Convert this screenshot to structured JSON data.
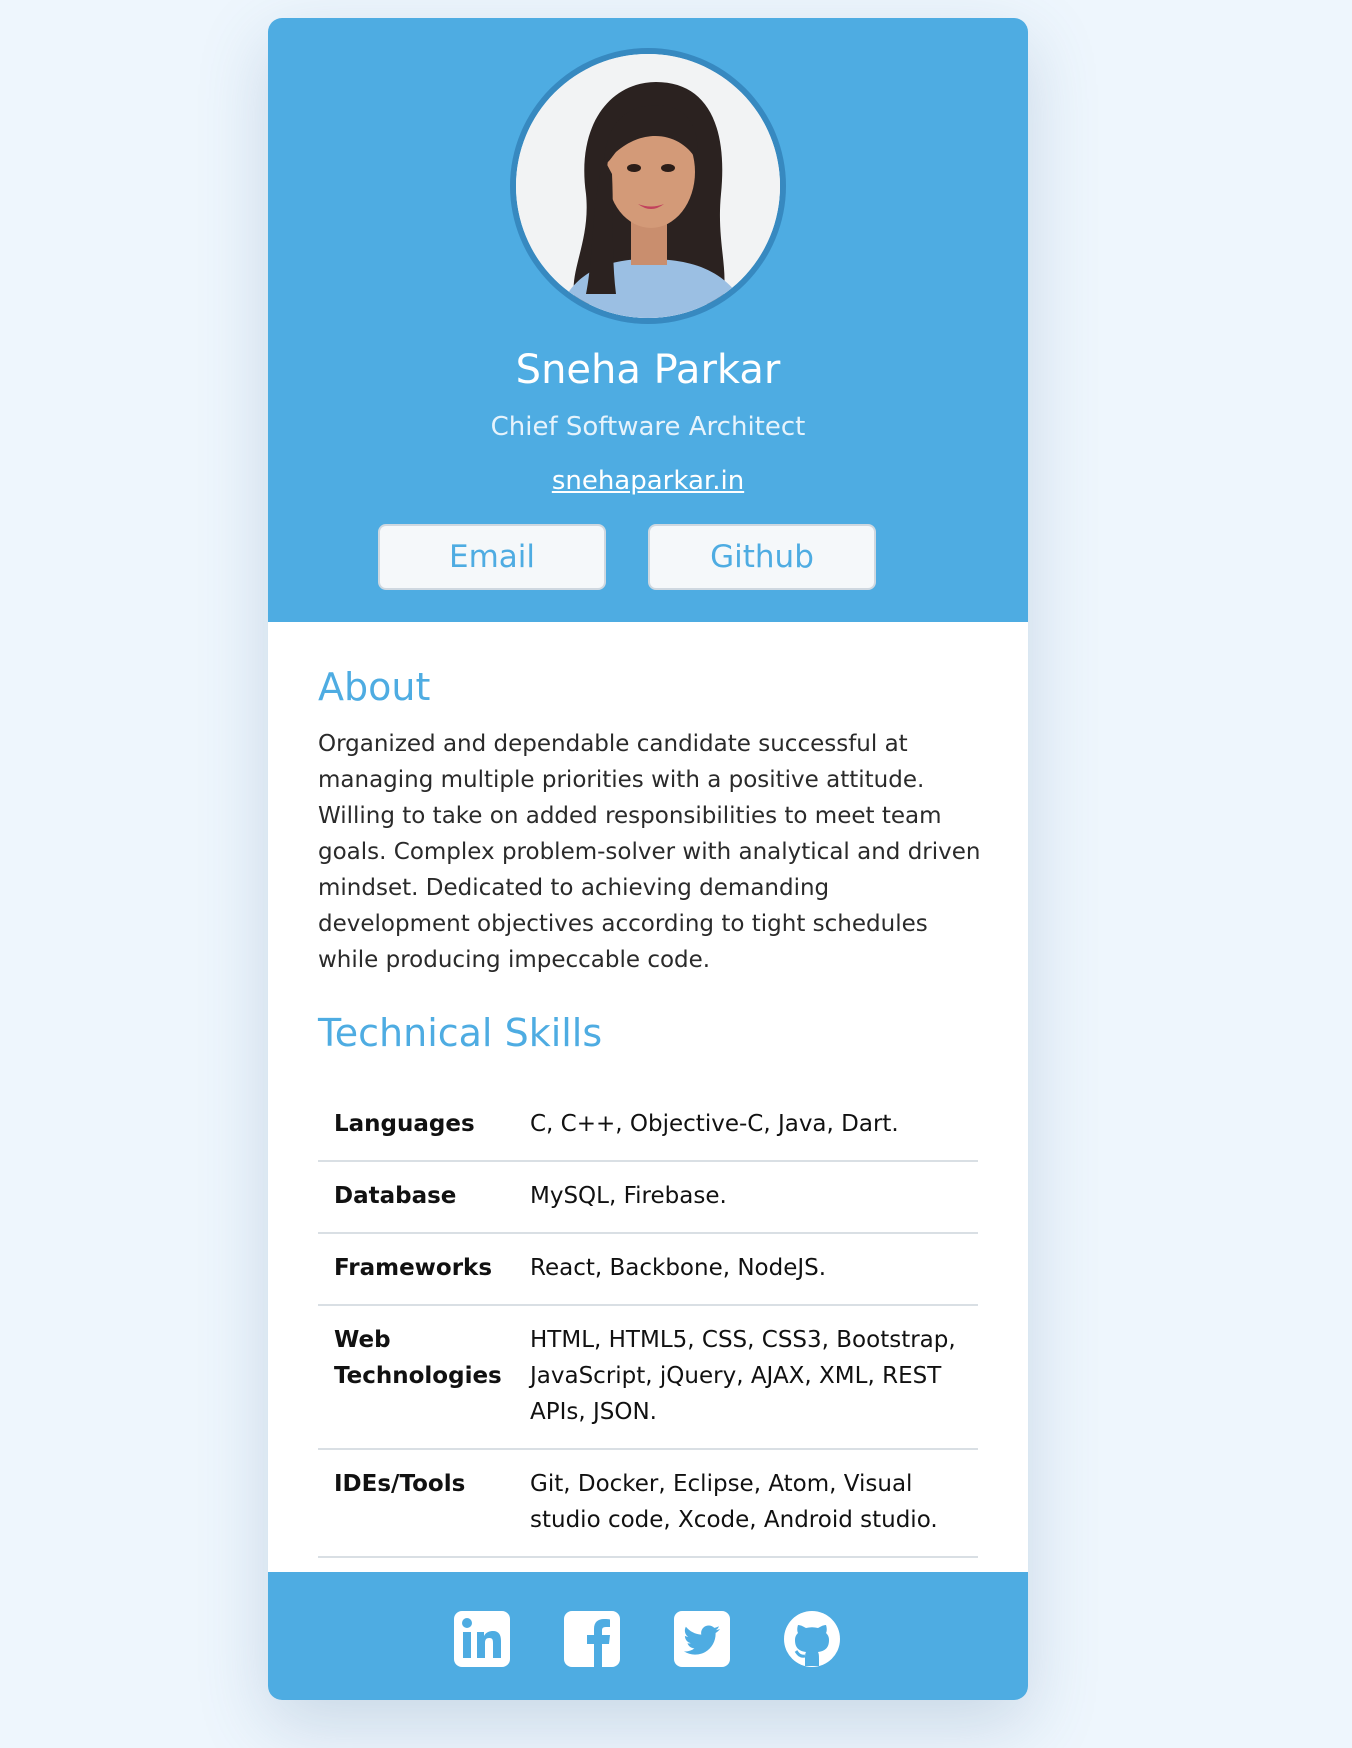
{
  "profile": {
    "name": "Sneha Parkar",
    "role": "Chief Software Architect",
    "website": "snehaparkar.in"
  },
  "buttons": {
    "email": "Email",
    "github": "Github"
  },
  "about": {
    "title": "About",
    "text": "Organized and dependable candidate successful at managing multiple priorities with a positive attitude. Willing to take on added responsibilities to meet team goals. Complex problem-solver with analytical and driven mindset. Dedicated to achieving demanding development objectives according to tight schedules while producing impeccable code."
  },
  "skills": {
    "title": "Technical Skills",
    "rows": [
      {
        "key": "Languages",
        "value": "C, C++, Objective-C, Java, Dart."
      },
      {
        "key": "Database",
        "value": "MySQL, Firebase."
      },
      {
        "key": "Frameworks",
        "value": "React, Backbone, NodeJS."
      },
      {
        "key": "Web Technologies",
        "value": "HTML, HTML5, CSS, CSS3, Bootstrap, JavaScript, jQuery, AJAX, XML, REST APIs, JSON."
      },
      {
        "key": "IDEs/Tools",
        "value": "Git, Docker, Eclipse, Atom, Visual studio code, Xcode, Android studio."
      }
    ]
  },
  "footer": {
    "icons": [
      "linkedin-icon",
      "facebook-icon",
      "twitter-icon",
      "github-icon"
    ]
  },
  "colors": {
    "accent": "#4eace2",
    "page_background": "#eef6fd"
  }
}
